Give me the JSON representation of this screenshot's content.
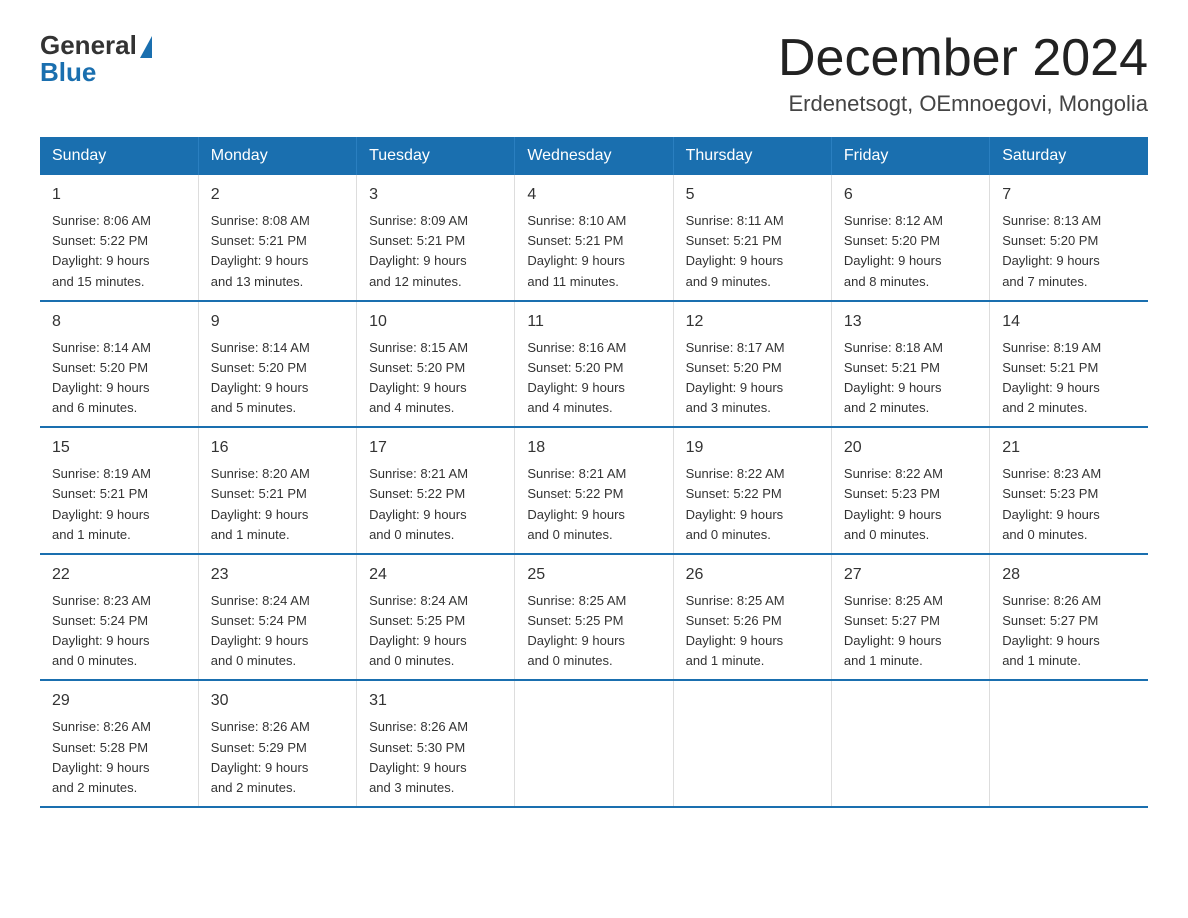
{
  "logo": {
    "general": "General",
    "blue": "Blue"
  },
  "title": "December 2024",
  "subtitle": "Erdenetsogt, OEmnoegovi, Mongolia",
  "days_header": [
    "Sunday",
    "Monday",
    "Tuesday",
    "Wednesday",
    "Thursday",
    "Friday",
    "Saturday"
  ],
  "weeks": [
    [
      {
        "day": "1",
        "sunrise": "8:06 AM",
        "sunset": "5:22 PM",
        "daylight": "9 hours and 15 minutes."
      },
      {
        "day": "2",
        "sunrise": "8:08 AM",
        "sunset": "5:21 PM",
        "daylight": "9 hours and 13 minutes."
      },
      {
        "day": "3",
        "sunrise": "8:09 AM",
        "sunset": "5:21 PM",
        "daylight": "9 hours and 12 minutes."
      },
      {
        "day": "4",
        "sunrise": "8:10 AM",
        "sunset": "5:21 PM",
        "daylight": "9 hours and 11 minutes."
      },
      {
        "day": "5",
        "sunrise": "8:11 AM",
        "sunset": "5:21 PM",
        "daylight": "9 hours and 9 minutes."
      },
      {
        "day": "6",
        "sunrise": "8:12 AM",
        "sunset": "5:20 PM",
        "daylight": "9 hours and 8 minutes."
      },
      {
        "day": "7",
        "sunrise": "8:13 AM",
        "sunset": "5:20 PM",
        "daylight": "9 hours and 7 minutes."
      }
    ],
    [
      {
        "day": "8",
        "sunrise": "8:14 AM",
        "sunset": "5:20 PM",
        "daylight": "9 hours and 6 minutes."
      },
      {
        "day": "9",
        "sunrise": "8:14 AM",
        "sunset": "5:20 PM",
        "daylight": "9 hours and 5 minutes."
      },
      {
        "day": "10",
        "sunrise": "8:15 AM",
        "sunset": "5:20 PM",
        "daylight": "9 hours and 4 minutes."
      },
      {
        "day": "11",
        "sunrise": "8:16 AM",
        "sunset": "5:20 PM",
        "daylight": "9 hours and 4 minutes."
      },
      {
        "day": "12",
        "sunrise": "8:17 AM",
        "sunset": "5:20 PM",
        "daylight": "9 hours and 3 minutes."
      },
      {
        "day": "13",
        "sunrise": "8:18 AM",
        "sunset": "5:21 PM",
        "daylight": "9 hours and 2 minutes."
      },
      {
        "day": "14",
        "sunrise": "8:19 AM",
        "sunset": "5:21 PM",
        "daylight": "9 hours and 2 minutes."
      }
    ],
    [
      {
        "day": "15",
        "sunrise": "8:19 AM",
        "sunset": "5:21 PM",
        "daylight": "9 hours and 1 minute."
      },
      {
        "day": "16",
        "sunrise": "8:20 AM",
        "sunset": "5:21 PM",
        "daylight": "9 hours and 1 minute."
      },
      {
        "day": "17",
        "sunrise": "8:21 AM",
        "sunset": "5:22 PM",
        "daylight": "9 hours and 0 minutes."
      },
      {
        "day": "18",
        "sunrise": "8:21 AM",
        "sunset": "5:22 PM",
        "daylight": "9 hours and 0 minutes."
      },
      {
        "day": "19",
        "sunrise": "8:22 AM",
        "sunset": "5:22 PM",
        "daylight": "9 hours and 0 minutes."
      },
      {
        "day": "20",
        "sunrise": "8:22 AM",
        "sunset": "5:23 PM",
        "daylight": "9 hours and 0 minutes."
      },
      {
        "day": "21",
        "sunrise": "8:23 AM",
        "sunset": "5:23 PM",
        "daylight": "9 hours and 0 minutes."
      }
    ],
    [
      {
        "day": "22",
        "sunrise": "8:23 AM",
        "sunset": "5:24 PM",
        "daylight": "9 hours and 0 minutes."
      },
      {
        "day": "23",
        "sunrise": "8:24 AM",
        "sunset": "5:24 PM",
        "daylight": "9 hours and 0 minutes."
      },
      {
        "day": "24",
        "sunrise": "8:24 AM",
        "sunset": "5:25 PM",
        "daylight": "9 hours and 0 minutes."
      },
      {
        "day": "25",
        "sunrise": "8:25 AM",
        "sunset": "5:25 PM",
        "daylight": "9 hours and 0 minutes."
      },
      {
        "day": "26",
        "sunrise": "8:25 AM",
        "sunset": "5:26 PM",
        "daylight": "9 hours and 1 minute."
      },
      {
        "day": "27",
        "sunrise": "8:25 AM",
        "sunset": "5:27 PM",
        "daylight": "9 hours and 1 minute."
      },
      {
        "day": "28",
        "sunrise": "8:26 AM",
        "sunset": "5:27 PM",
        "daylight": "9 hours and 1 minute."
      }
    ],
    [
      {
        "day": "29",
        "sunrise": "8:26 AM",
        "sunset": "5:28 PM",
        "daylight": "9 hours and 2 minutes."
      },
      {
        "day": "30",
        "sunrise": "8:26 AM",
        "sunset": "5:29 PM",
        "daylight": "9 hours and 2 minutes."
      },
      {
        "day": "31",
        "sunrise": "8:26 AM",
        "sunset": "5:30 PM",
        "daylight": "9 hours and 3 minutes."
      },
      null,
      null,
      null,
      null
    ]
  ],
  "labels": {
    "sunrise": "Sunrise:",
    "sunset": "Sunset:",
    "daylight": "Daylight:"
  }
}
